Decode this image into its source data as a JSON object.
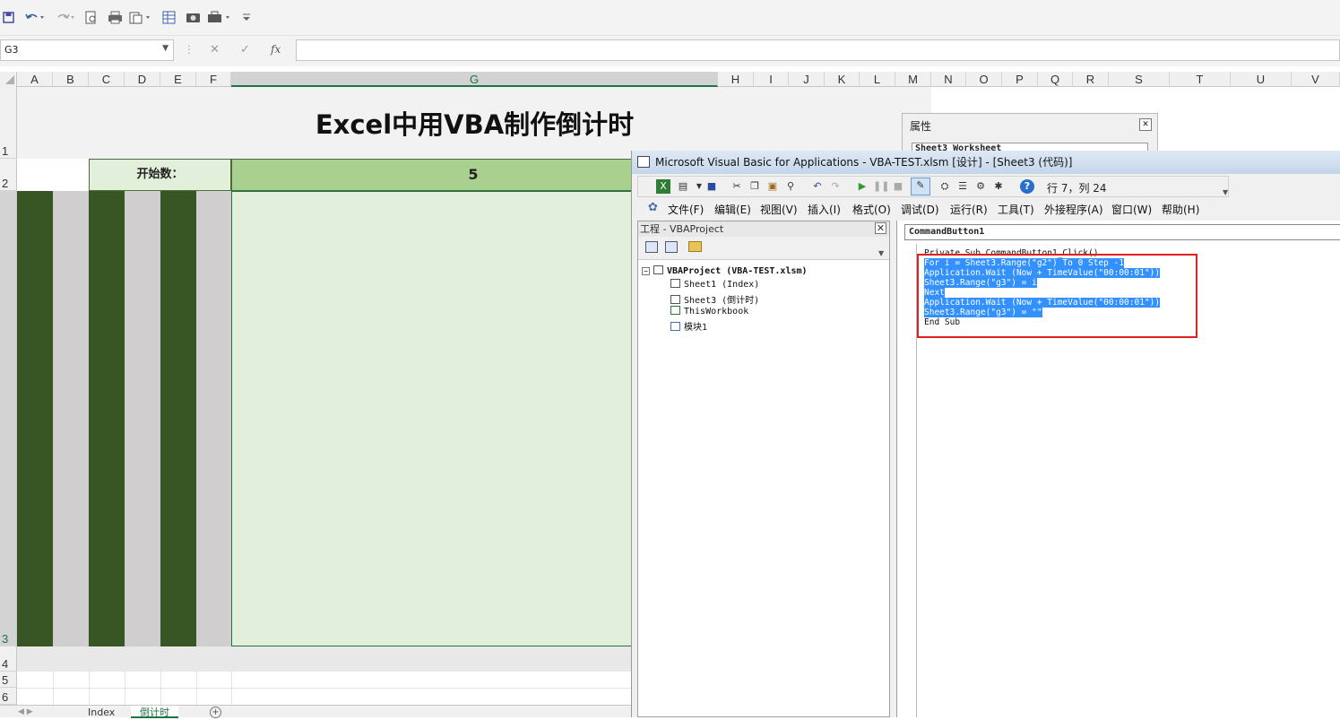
{
  "qat": {
    "icons": [
      "save-icon",
      "undo-icon",
      "redo-icon",
      "print-preview-icon",
      "print-icon",
      "paste-icon",
      "table-icon",
      "camera-icon",
      "toolbox-icon",
      "customize-icon"
    ]
  },
  "formula_bar": {
    "name_box": "G3",
    "cancel": "✕",
    "confirm": "✓",
    "fx": "fx",
    "value": ""
  },
  "columns": [
    "A",
    "B",
    "C",
    "D",
    "E",
    "F",
    "G",
    "H",
    "I",
    "J",
    "K",
    "L",
    "M",
    "N",
    "O",
    "P",
    "Q",
    "R",
    "S",
    "T",
    "U",
    "V"
  ],
  "rows": [
    "1",
    "2",
    "3",
    "4",
    "5",
    "6"
  ],
  "sheet": {
    "title": "Excel中用VBA制作倒计时",
    "start_label": "开始数：",
    "start_value": "5"
  },
  "tabs": [
    "Index",
    "倒计时"
  ],
  "properties": {
    "title": "属性",
    "object": "Sheet3 Worksheet"
  },
  "vbe": {
    "title": "Microsoft Visual Basic for Applications - VBA-TEST.xlsm [设计] - [Sheet3 (代码)]",
    "position": "行 7，列 24",
    "menu": [
      "文件(F)",
      "编辑(E)",
      "视图(V)",
      "插入(I)",
      "格式(O)",
      "调试(D)",
      "运行(R)",
      "工具(T)",
      "外接程序(A)",
      "窗口(W)",
      "帮助(H)"
    ],
    "project_title": "工程 - VBAProject",
    "tree": {
      "root": "VBAProject (VBA-TEST.xlsm)",
      "items": [
        "Sheet1 (Index)",
        "Sheet3 (倒计时)",
        "ThisWorkbook",
        "模块1"
      ]
    },
    "object_box": "CommandButton1",
    "code_lines": [
      "Private Sub CommandButton1_Click()",
      "For i = Sheet3.Range(\"g2\") To 0 Step -1",
      "Application.Wait (Now + TimeValue(\"00:00:01\"))",
      "Sheet3.Range(\"g3\") = i",
      "Next",
      "Application.Wait (Now + TimeValue(\"00:00:01\"))",
      "Sheet3.Range(\"g3\") = \"\"",
      "End Sub"
    ]
  },
  "colors": {
    "accent": "#217346",
    "dark_green": "#375623",
    "light_grey": "#d0cece",
    "header_green": "#a9d08e",
    "light_green": "#e2efda",
    "selection": "#3390ff",
    "highlight_box": "#e02020"
  }
}
